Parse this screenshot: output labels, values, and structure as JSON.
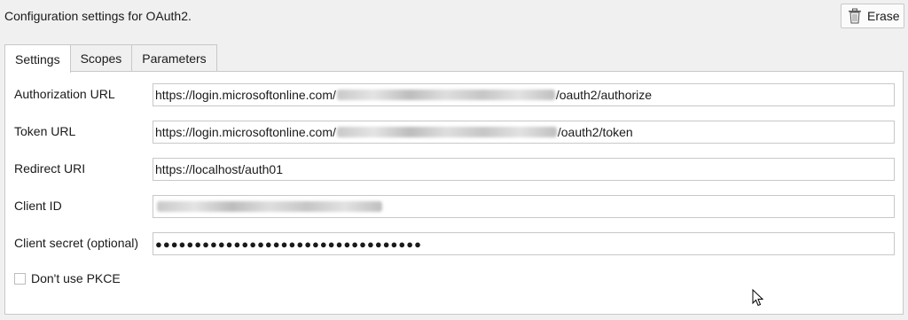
{
  "header": {
    "title": "Configuration settings for OAuth2.",
    "erase_label": "Erase"
  },
  "tabs": [
    {
      "label": "Settings",
      "active": true
    },
    {
      "label": "Scopes",
      "active": false
    },
    {
      "label": "Parameters",
      "active": false
    }
  ],
  "form": {
    "authorization_url": {
      "label": "Authorization URL",
      "prefix": "https://login.microsoftonline.com/",
      "suffix": "/oauth2/authorize"
    },
    "token_url": {
      "label": "Token URL",
      "prefix": "https://login.microsoftonline.com/",
      "suffix": "/oauth2/token"
    },
    "redirect_uri": {
      "label": "Redirect URI",
      "value": "https://localhost/auth01"
    },
    "client_id": {
      "label": "Client ID"
    },
    "client_secret": {
      "label": "Client secret (optional)",
      "value": "●●●●●●●●●●●●●●●●●●●●●●●●●●●●●●●●●●"
    },
    "dont_use_pkce": {
      "label": "Don't use PKCE",
      "checked": false
    }
  },
  "colors": {
    "background": "#f0f0f0",
    "border": "#c8c8c8",
    "panel": "#ffffff"
  },
  "icons": {
    "erase": "trash-icon",
    "cursor": "mouse-pointer-icon"
  }
}
